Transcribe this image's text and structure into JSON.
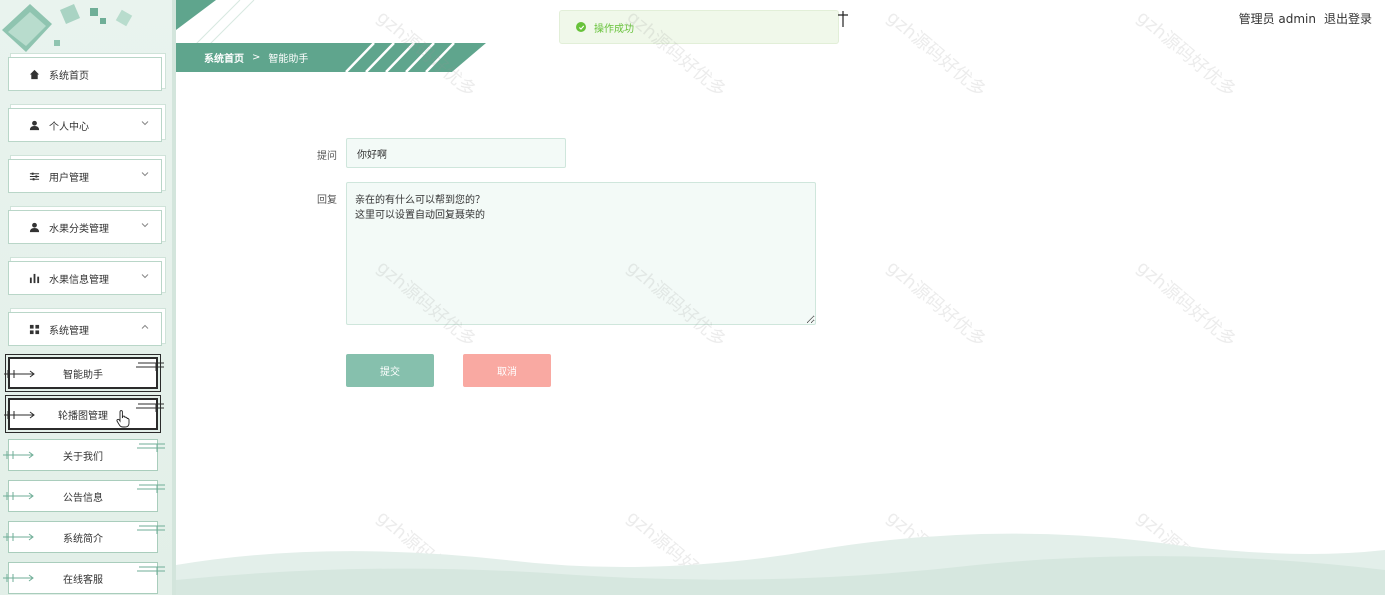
{
  "sidebar": {
    "items": [
      {
        "label": "系统首页",
        "icon": "home-icon",
        "chevron": false
      },
      {
        "label": "个人中心",
        "icon": "user-icon",
        "chevron": true
      },
      {
        "label": "用户管理",
        "icon": "sliders-icon",
        "chevron": true
      },
      {
        "label": "水果分类管理",
        "icon": "user-icon",
        "chevron": true
      },
      {
        "label": "水果信息管理",
        "icon": "bar-chart-icon",
        "chevron": true
      },
      {
        "label": "系统管理",
        "icon": "grid-icon",
        "chevron": true,
        "expanded": true
      }
    ],
    "sub_items": [
      {
        "label": "智能助手",
        "active": true
      },
      {
        "label": "轮播图管理",
        "active": true
      },
      {
        "label": "关于我们",
        "active": false
      },
      {
        "label": "公告信息",
        "active": false
      },
      {
        "label": "系统简介",
        "active": false
      },
      {
        "label": "在线客服",
        "active": false
      }
    ]
  },
  "breadcrumb": {
    "home": "系统首页",
    "separator": ">",
    "current": "智能助手"
  },
  "toast": {
    "message": "操作成功",
    "type": "success"
  },
  "header": {
    "user": "管理员 admin",
    "logout": "退出登录"
  },
  "form": {
    "question_label": "提问",
    "question_value": "你好啊",
    "reply_label": "回复",
    "reply_value": "亲在的有什么可以帮到您的？\n这里可以设置自动回复聂荣的",
    "submit_label": "提交",
    "cancel_label": "取消"
  },
  "watermark": "gzh源码好优多",
  "colors": {
    "accent": "#5fa58d",
    "submit": "#86c0ad",
    "cancel": "#f9a9a2",
    "success": "#67c23a"
  }
}
